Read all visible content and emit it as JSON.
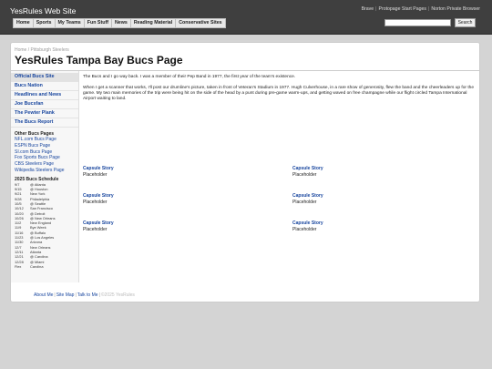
{
  "site_name": "YesRules Web Site",
  "top_links": [
    "Brave",
    "Protopage Start Pages",
    "Norton Private Browser"
  ],
  "menu": [
    "Home",
    "Sports",
    "My Teams",
    "Fun Stuff",
    "News",
    "Reading Material",
    "Conservative Sites"
  ],
  "search": {
    "value": "",
    "button_label": "Search"
  },
  "breadcrumb": {
    "home": "Home",
    "separator": "/",
    "current": "Pittsburgh Steelers"
  },
  "page_title": "YesRules Tampa Bay Bucs Page",
  "sidebar": {
    "nav": [
      "Official Bucs Site",
      "Bucs Nation",
      "Headlines and News",
      "Joe Bucsfan",
      "The Pewter Plank",
      "The Bucs Report"
    ],
    "other_heading": "Other Bucs Pages",
    "other_links": [
      "NFL.com Bucs Page",
      "ESPN Bucs Page",
      "SI.com Bucs Page",
      "Fox Sports Bucs Page",
      "CBS Steelers Page",
      "Wikipedia Steelers Page"
    ],
    "schedule_heading": "2025 Bucs Schedule",
    "schedule": [
      {
        "date": "9/7",
        "opponent": "@ Atlanta"
      },
      {
        "date": "9/15",
        "opponent": "@ Houston"
      },
      {
        "date": "9/21",
        "opponent": "New York"
      },
      {
        "date": "9/28",
        "opponent": "Philadelphia"
      },
      {
        "date": "10/5",
        "opponent": "@ Seattle"
      },
      {
        "date": "10/12",
        "opponent": "San Francisco"
      },
      {
        "date": "10/20",
        "opponent": "@ Detroit"
      },
      {
        "date": "10/26",
        "opponent": "@ New Orleans"
      },
      {
        "date": "11/2",
        "opponent": "New England"
      },
      {
        "date": "11/9",
        "opponent": "Bye Week"
      },
      {
        "date": "11/16",
        "opponent": "@ Buffalo"
      },
      {
        "date": "11/23",
        "opponent": "@ Los Angeles"
      },
      {
        "date": "11/30",
        "opponent": "Arizona"
      },
      {
        "date": "12/7",
        "opponent": "New Orleans"
      },
      {
        "date": "12/11",
        "opponent": "Atlanta"
      },
      {
        "date": "12/21",
        "opponent": "@ Carolina"
      },
      {
        "date": "12/28",
        "opponent": "@ Miami"
      },
      {
        "date": "Flex",
        "opponent": "Carolina"
      }
    ]
  },
  "main": {
    "paragraphs": [
      "The Bucs and I go way back. I was a member of their Pep Band in 1977, the first year of the team's existence.",
      "When I get a scanner that works, I'll post our drumline's picture, taken in front of Veteran's Stadium in 1977. Hugh Culverhouse, in a rare show of generosity, flew the band and the cheerleaders up for the game. My two main memories of the trip were being hit on the side of the head by a punt during pre-game warm-ups, and getting waved on free champagne while our flight circled Tampa International Airport waiting to land."
    ],
    "captions": [
      {
        "title": "Capsule Story",
        "text": "Placeholder"
      },
      {
        "title": "Capsule Story",
        "text": "Placeholder"
      },
      {
        "title": "Capsule Story",
        "text": "Placeholder"
      },
      {
        "title": "Capsule Story",
        "text": "Placeholder"
      },
      {
        "title": "Capsule Story",
        "text": "Placeholder"
      },
      {
        "title": "Capsule Story",
        "text": "Placeholder"
      }
    ]
  },
  "footer": {
    "links": [
      "About Me",
      "Site Map",
      "Talk to Me"
    ],
    "copyright": "©2025 YesRules"
  }
}
